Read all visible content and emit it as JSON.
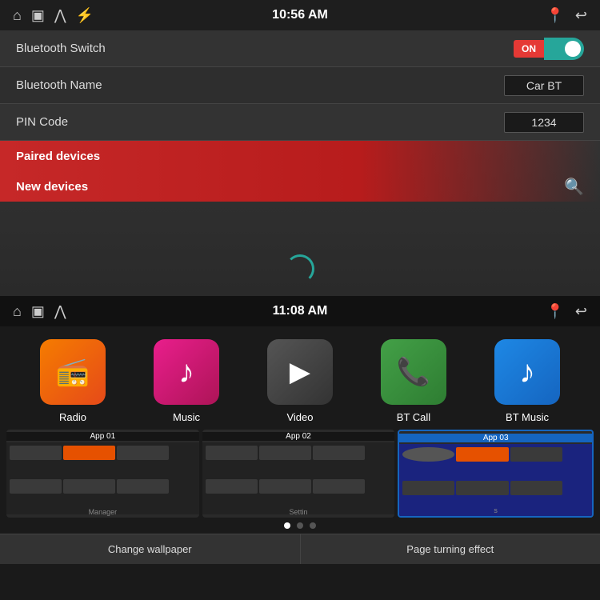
{
  "top": {
    "statusBar": {
      "time": "10:56 AM",
      "icons": [
        "⌂",
        "▣",
        "⋀",
        "⚡"
      ]
    },
    "bluetooth_switch_label": "Bluetooth Switch",
    "bluetooth_switch_value": "ON",
    "bluetooth_name_label": "Bluetooth Name",
    "bluetooth_name_value": "Car BT",
    "pin_code_label": "PIN Code",
    "pin_code_value": "1234",
    "paired_devices_label": "Paired devices",
    "new_devices_label": "New devices"
  },
  "bottom": {
    "statusBar": {
      "time": "11:08 AM",
      "icons": [
        "⌂",
        "▣",
        "⋀"
      ]
    },
    "apps": [
      {
        "id": "radio",
        "label": "Radio",
        "iconClass": "app-icon-radio",
        "symbol": "📻"
      },
      {
        "id": "music",
        "label": "Music",
        "iconClass": "app-icon-music",
        "symbol": "♪"
      },
      {
        "id": "video",
        "label": "Video",
        "iconClass": "app-icon-video",
        "symbol": "▶"
      },
      {
        "id": "btcall",
        "label": "BT Call",
        "iconClass": "app-icon-btcall",
        "symbol": "📞"
      },
      {
        "id": "btmusic",
        "label": "BT Music",
        "iconClass": "app-icon-btmusic",
        "symbol": "♪"
      }
    ],
    "thumbnails": [
      {
        "id": "app01",
        "label": "App 01",
        "active": false
      },
      {
        "id": "app02",
        "label": "App 02",
        "active": false
      },
      {
        "id": "app03",
        "label": "App 03",
        "active": true
      }
    ],
    "dots": [
      true,
      false,
      false
    ],
    "bottomBar": {
      "left": "Change wallpaper",
      "right": "Page turning effect"
    }
  }
}
